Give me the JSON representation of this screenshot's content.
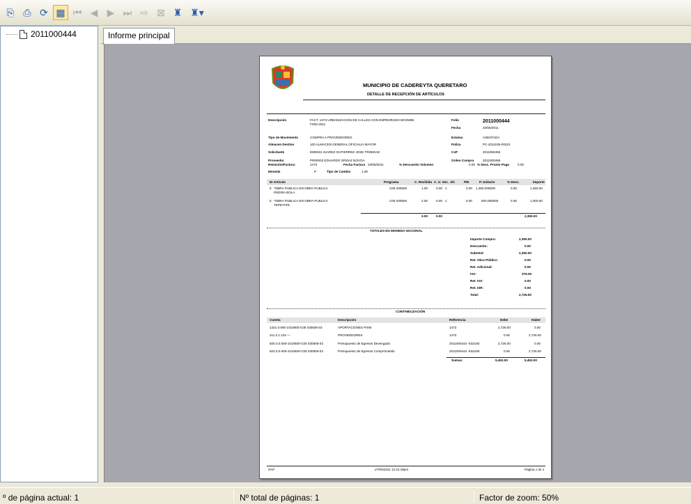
{
  "toolbar": {
    "buttons": [
      {
        "name": "export-icon",
        "glyph": "🗎"
      },
      {
        "name": "print-icon",
        "glyph": "🖶"
      },
      {
        "name": "refresh-icon",
        "glyph": "⟳"
      },
      {
        "name": "tree-toggle-icon",
        "glyph": "▦"
      },
      {
        "name": "first-page-icon",
        "glyph": "⏮"
      },
      {
        "name": "previous-page-icon",
        "glyph": "◀"
      },
      {
        "name": "next-page-icon",
        "glyph": "▶"
      },
      {
        "name": "last-page-icon",
        "glyph": "⏭"
      },
      {
        "name": "go-to-page-icon",
        "glyph": "⇨"
      },
      {
        "name": "stop-icon",
        "glyph": "⊠"
      },
      {
        "name": "search-icon",
        "glyph": "🔍"
      },
      {
        "name": "zoom-icon",
        "glyph": "🔎▾"
      }
    ]
  },
  "tree": {
    "node_label": "2011000444"
  },
  "tab": {
    "label": "Informe principal"
  },
  "report": {
    "org": "MUNICIPIO DE CADEREYTA QUERETARO",
    "title": "DETALLE DE RECEPCIÓN DE ARTÍCULOS",
    "info": {
      "descripcion_label": "Descripción",
      "descripcion": "FACT. 1473 URBANIZACION DE CALLES CON EMPEDRADO BOXMINI",
      "descripcion2": "FISM 2011",
      "folio_label": "Folio",
      "folio": "2011000444",
      "fecha_label": "Fecha",
      "fecha": "23/05/2011",
      "tipo_mov_label": "Tipo de Movimiento",
      "tipo_mov": "COMPRA A PROVEEDORES",
      "estatus_label": "Estatus",
      "estatus": "ASENTADA",
      "almacen_label": "Almacen Destino",
      "almacen": "100    ALMACEN GENERAL OFICIALIA MAYOR",
      "poliza_label": "Poliza",
      "poliza": "PC-2011105-00222",
      "solicitante_label": "Solicitante",
      "solicitante": "EM0023   JUAREZ GUTIERREZ JOSE TRINIDAD",
      "cxp_label": "CxP",
      "cxp": "2011050455",
      "proveedor_label": "Proveedor",
      "proveedor": "PR00002 EDUARDO ORDAZ NOVOA",
      "orden_label": "Orden Compra",
      "orden": "2011000466",
      "remision_label": "Remisión/Factura",
      "remision": "1473",
      "fecha_factura_label": "Fecha Factura",
      "fecha_factura": "23/05/2011",
      "desc_vol_label": "% Descuento Volumen",
      "desc_vol": "0.00",
      "desc_pronto_label": "% Desc. Pronto Pago",
      "desc_pronto": "0.00",
      "moneda_label": "Moneda",
      "moneda": "P",
      "tipo_cambio_label": "Tipo de Cambio",
      "tipo_cambio": "1.00"
    },
    "items_headers": [
      "ID Artículo",
      "Programa",
      "C. Recibida",
      "C. U. Sec.",
      "J/C",
      "PIE",
      "P. Unitario",
      "% Desc.",
      "Importe"
    ],
    "items": [
      {
        "id": "5",
        "desc": "*OBRA PUBLICA EN OBRA PUBLICA",
        "desc2": "PIEDRA BOLA",
        "prog": "C05 030505",
        "cr": "1.00",
        "cu": "0.00",
        "jc": "J",
        "pie": "0.00",
        "pu": "1,350.000000",
        "pd": "0.00",
        "imp": "1,350.00"
      },
      {
        "id": "5",
        "desc": "*OBRA PUBLICA EN OBRA PUBLICA",
        "desc2": "TEPETATE",
        "prog": "C05 030505",
        "cr": "2.00",
        "cu": "0.00",
        "jc": "J",
        "pie": "0.00",
        "pu": "500.000000",
        "pd": "0.00",
        "imp": "1,000.00"
      }
    ],
    "items_totals": {
      "cr": "3.00",
      "cu": "0.00",
      "imp": "2,350.00"
    },
    "totals_title": "TOTALES EN MONEDA NACIONAL",
    "totals": [
      {
        "label": "Importe Compra:",
        "value": "2,350.00"
      },
      {
        "label": "Descuento:",
        "value": "0.00"
      },
      {
        "label": "Subtotal:",
        "value": "2,350.00"
      },
      {
        "label": "Ret. Obra Público:",
        "value": "0.00"
      },
      {
        "label": "Ret. Adicional:",
        "value": "0.00"
      },
      {
        "label": "IVA:",
        "value": "376.00"
      },
      {
        "label": "Ret. IVA:",
        "value": "0.00"
      },
      {
        "label": "Ret. ISR:",
        "value": "0.00"
      },
      {
        "label": "Total:",
        "value": "2,726.00"
      }
    ],
    "cont_title": "CONTABILIZACIÓN",
    "cont_headers": [
      "Cuenta",
      "Descripción",
      "Referencia",
      "Debe",
      "Haber"
    ],
    "cont_rows": [
      {
        "cuenta": "1321.0.000-1010600-C05   030505-03",
        "desc": "APORTACIONES FISM",
        "ref": "1473",
        "debe": "2,726.00",
        "haber": "0.00"
      },
      {
        "cuenta": "211.2.1.101----",
        "desc": "PROVEEDORES",
        "ref": "1473",
        "debe": "0.00",
        "haber": "2,726.00"
      },
      {
        "cuenta": "825.0.0.000-1010600-C05   030505-03",
        "desc": "Presupuesto de Egresos Devengado",
        "ref": "2011000444  -532160",
        "debe": "2,726.00",
        "haber": "0.00"
      },
      {
        "cuenta": "824.0.0.000-1010600-C05   030505-03",
        "desc": "Presupuesto de Egresos Comprometido",
        "ref": "2011000444  -532160",
        "debe": "0.00",
        "haber": "2,726.00"
      }
    ],
    "sumas_label": "Sumas:",
    "sumas_debe": "5,452.00",
    "sumas_haber": "5,452.00",
    "footer_left": "RAF",
    "footer_mid": "27/05/2011 12:31:39pm",
    "footer_right": "Página 1 de 1"
  },
  "status": {
    "page_current": "º de página actual: 1",
    "page_total": "Nº total de páginas: 1",
    "zoom": "Factor de zoom: 50%"
  }
}
